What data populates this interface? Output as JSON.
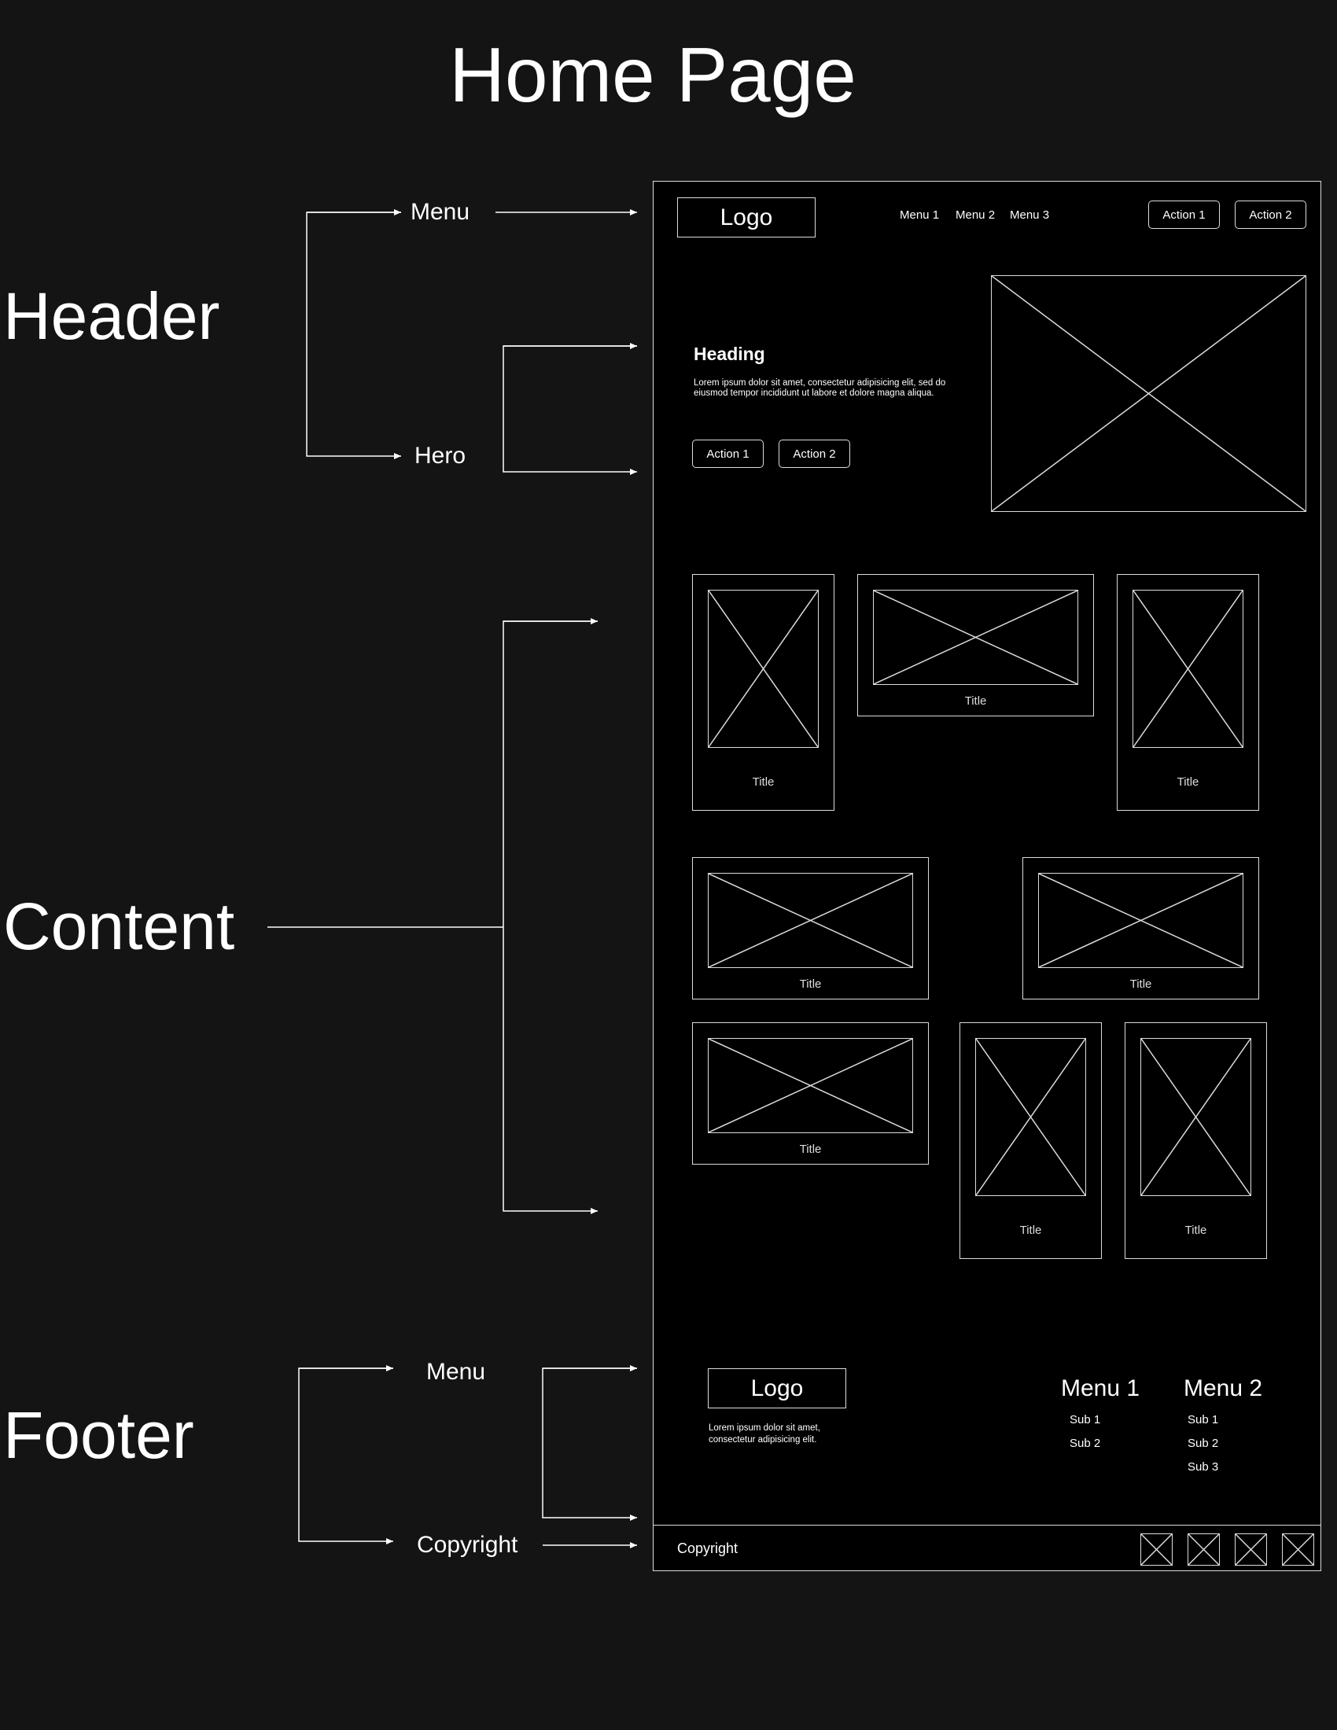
{
  "title": "Home Page",
  "sections": {
    "header": "Header",
    "content": "Content",
    "footer": "Footer"
  },
  "annotations": {
    "header_menu": "Menu",
    "header_hero": "Hero",
    "footer_menu": "Menu",
    "footer_copyright": "Copyright"
  },
  "mockup": {
    "header": {
      "logo": "Logo",
      "nav": [
        "Menu 1",
        "Menu 2",
        "Menu 3"
      ],
      "actions": [
        "Action 1",
        "Action 2"
      ]
    },
    "hero": {
      "heading": "Heading",
      "body": "Lorem ipsum dolor sit amet, consectetur adipisicing elit, sed do eiusmod tempor incididunt ut labore et dolore magna aliqua.",
      "actions": [
        "Action 1",
        "Action 2"
      ]
    },
    "content": {
      "card_title": "Title"
    },
    "footer": {
      "logo": "Logo",
      "description": "Lorem ipsum dolor sit amet, consectetur adipisicing elit.",
      "menus": [
        {
          "title": "Menu 1",
          "items": [
            "Sub 1",
            "Sub 2"
          ]
        },
        {
          "title": "Menu 2",
          "items": [
            "Sub 1",
            "Sub 2",
            "Sub 3"
          ]
        }
      ],
      "copyright": "Copyright"
    }
  },
  "colors": {
    "background": "#141414",
    "mockup_background": "#000000",
    "stroke": "#dcdcdc"
  }
}
